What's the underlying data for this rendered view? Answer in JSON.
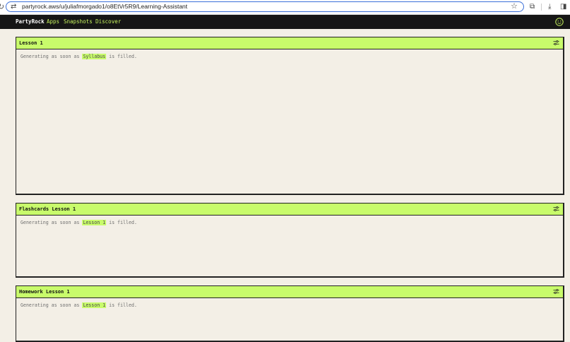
{
  "browser": {
    "url": "partyrock.aws/u/juliafmorgado1/o8EtVr5R9/Learning-Assistant"
  },
  "nav": {
    "brand": "PartyRock",
    "links": [
      "Apps",
      "Snapshots",
      "Discover"
    ]
  },
  "colors": {
    "accent": "#c8fb6b",
    "nav_bg": "#161616",
    "page_bg": "#f3efe6"
  },
  "cards": [
    {
      "title": "Lesson 1",
      "status_prefix": "Generating as soon as",
      "dependency": "Syllabus",
      "status_suffix": "is filled."
    },
    {
      "title": "Flashcards Lesson 1",
      "status_prefix": "Generating as soon as",
      "dependency": "Lesson 1",
      "status_suffix": "is filled."
    },
    {
      "title": "Homework Lesson 1",
      "status_prefix": "Generating as soon as",
      "dependency": "Lesson 1",
      "status_suffix": "is filled."
    }
  ]
}
